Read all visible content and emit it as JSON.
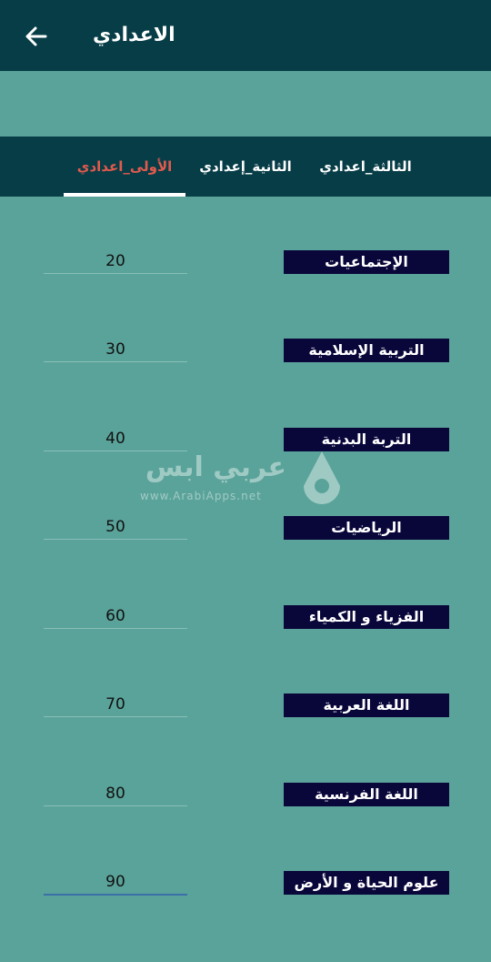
{
  "header": {
    "title": "الاعدادي",
    "back_icon": "arrow-left-icon"
  },
  "tabs": [
    {
      "label": "الثالثة_اعدادي",
      "active": false
    },
    {
      "label": "الثانية_إعدادي",
      "active": false
    },
    {
      "label": "الأولى_اعدادي",
      "active": true
    }
  ],
  "subjects": [
    {
      "name": "الإجتماعيات",
      "value": "20"
    },
    {
      "name": "التربية الإسلامية",
      "value": "30"
    },
    {
      "name": "التربة البدنية",
      "value": "40"
    },
    {
      "name": "الرياضيات",
      "value": "50"
    },
    {
      "name": "الفزياء و الكمياء",
      "value": "60"
    },
    {
      "name": "اللغة العربية",
      "value": "70"
    },
    {
      "name": "اللغة الفرنسية",
      "value": "80"
    },
    {
      "name": "علوم الحياة و الأرض",
      "value": "90"
    }
  ],
  "watermark": {
    "text_ar": "عربي ابس",
    "url": "www.ArabiApps.net"
  },
  "colors": {
    "appbar": "#073d47",
    "background": "#5aa39a",
    "subject_bg": "#09063a",
    "active_tab": "#e25a4d"
  }
}
